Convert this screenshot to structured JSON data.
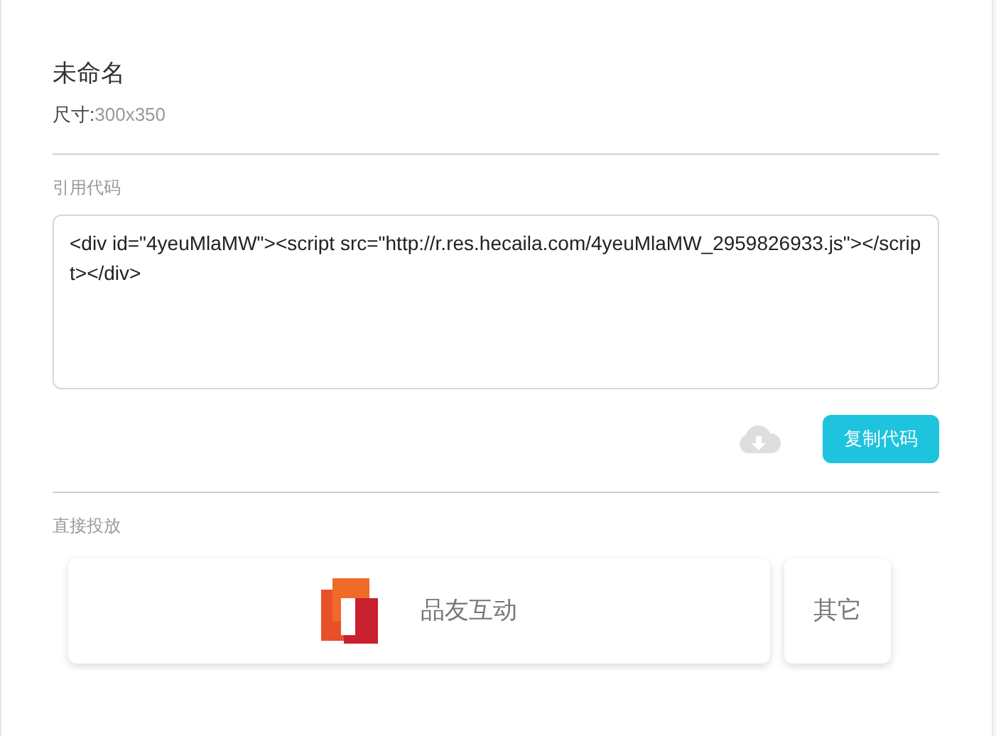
{
  "title": "未命名",
  "size": {
    "label": "尺寸:",
    "value": "300x350"
  },
  "embed": {
    "label": "引用代码",
    "code": "<div id=\"4yeuMlaMW\"><script src=\"http://r.res.hecaila.com/4yeuMlaMW_2959826933.js\"></script></div>",
    "copy_button": "复制代码"
  },
  "direct": {
    "label": "直接投放",
    "platforms": [
      {
        "kind": "brand",
        "name": "品友互动"
      },
      {
        "kind": "text",
        "name": "其它"
      }
    ]
  }
}
